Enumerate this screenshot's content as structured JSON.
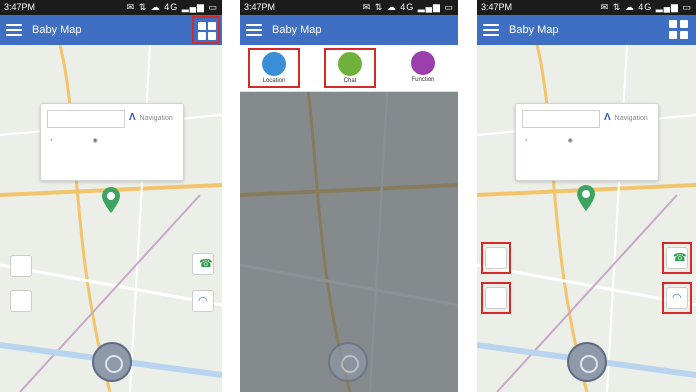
{
  "status": {
    "time": "3:47PM",
    "icons": "✉ ⇅ ☁ 4G ▂▄▆ ▭"
  },
  "app": {
    "title": "Baby Map"
  },
  "info_card": {
    "navigation": "Navigation"
  },
  "menu": {
    "location": "Location",
    "chat": "Chat",
    "function": "Function"
  },
  "colors": {
    "appbar": "#3f6fc2",
    "highlight": "#d42a2a",
    "marker": "#3fa463"
  },
  "icons": [
    "menu-icon",
    "grid-icon",
    "phone-icon",
    "headset-icon",
    "sim-card-icon",
    "smartphone-icon",
    "locate-icon",
    "navigation-icon"
  ]
}
